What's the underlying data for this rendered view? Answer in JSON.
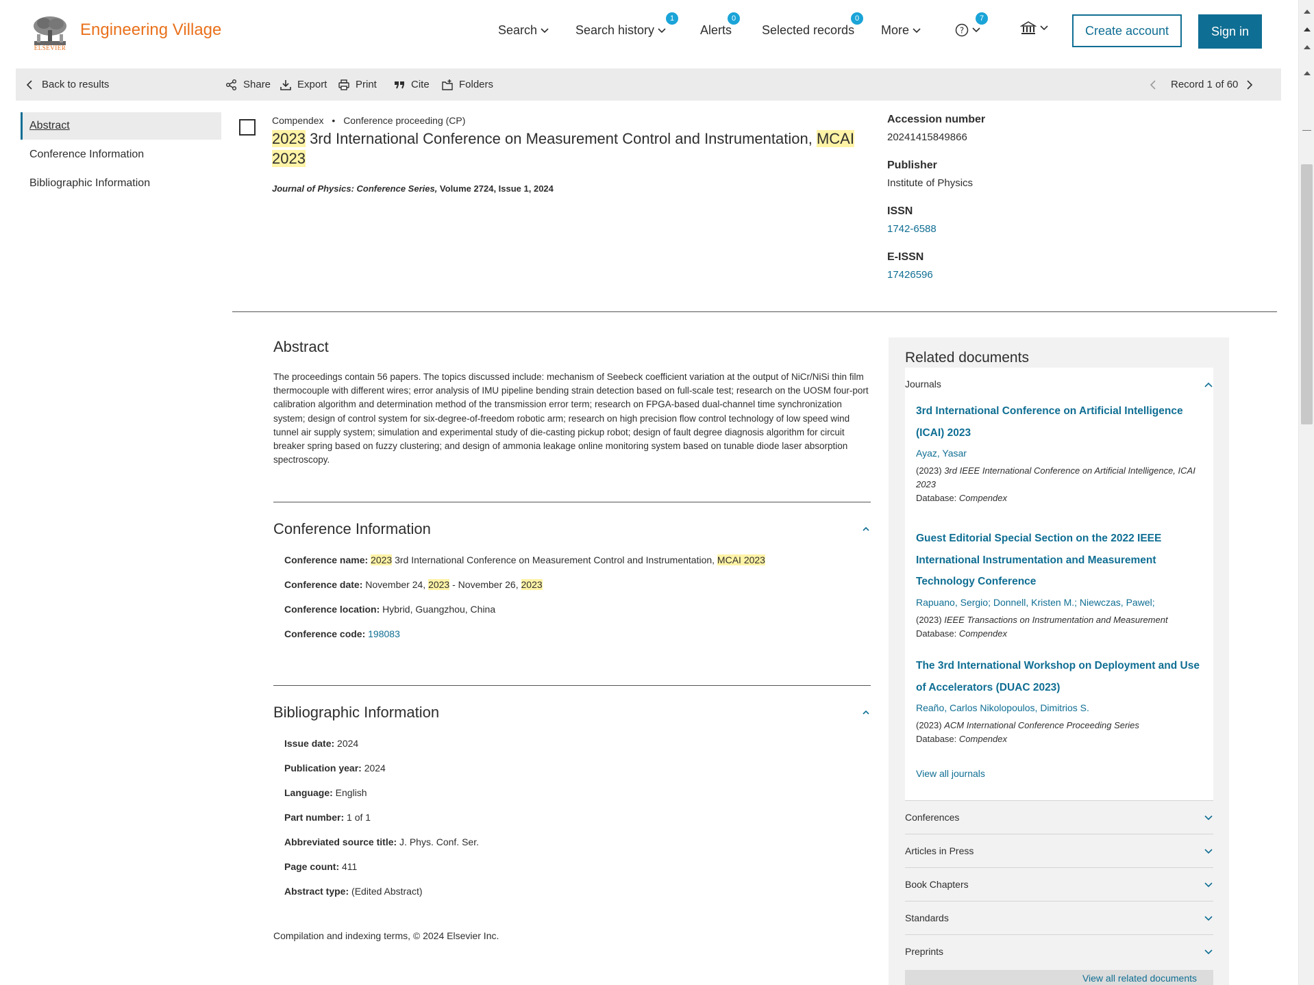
{
  "header": {
    "brand": "Engineering Village",
    "logo_word": "ELSEVIER",
    "nav": {
      "search": "Search",
      "search_history": "Search history",
      "search_history_badge": "1",
      "alerts": "Alerts",
      "alerts_badge": "0",
      "selected_records": "Selected records",
      "selected_records_badge": "0",
      "more": "More",
      "help_badge": "7"
    },
    "create_account": "Create account",
    "sign_in": "Sign in"
  },
  "toolbar": {
    "back": "Back to results",
    "share": "Share",
    "export": "Export",
    "print": "Print",
    "cite": "Cite",
    "folders": "Folders",
    "record_position": "Record 1 of 60"
  },
  "leftnav": {
    "abstract": "Abstract",
    "conference_information": "Conference Information",
    "bibliographic_information": "Bibliographic Information"
  },
  "record": {
    "database": "Compendex",
    "separator": "•",
    "doc_type": "Conference proceeding (CP)",
    "title_hl_1": "2023",
    "title_mid": " 3rd International Conference on Measurement Control and Instrumentation, ",
    "title_hl_2": "MCAI",
    "title_hl_3": "2023",
    "source_journal": "Journal of Physics: Conference Series,",
    "source_rest": " Volume 2724, Issue 1, 2024"
  },
  "right_meta": {
    "accession_label": "Accession number",
    "accession_value": "20241415849866",
    "publisher_label": "Publisher",
    "publisher_value": "Institute of Physics",
    "issn_label": "ISSN",
    "issn_value": "1742-6588",
    "eissn_label": "E-ISSN",
    "eissn_value": "17426596"
  },
  "abstract": {
    "heading": "Abstract",
    "text": "The proceedings contain 56 papers. The topics discussed include: mechanism of Seebeck coefficient variation at the output of NiCr/NiSi thin film thermocouple with different wires; error analysis of IMU pipeline bending strain detection based on full-scale test; research on the UOSM four-port calibration algorithm and determination method of the transmission error term; research on FPGA-based dual-channel time synchronization system; design of control system for six-degree-of-freedom robotic arm; research on high precision flow control technology of low speed wind tunnel air supply system; simulation and experimental study of die-casting pickup robot; design of fault degree diagnosis algorithm for circuit breaker spring based on fuzzy clustering; and design of ammonia leakage online monitoring system based on tunable diode laser absorption spectroscopy."
  },
  "conference": {
    "heading": "Conference Information",
    "name_label": "Conference name:",
    "name_hl_1": "2023",
    "name_mid": " 3rd International Conference on Measurement Control and Instrumentation, ",
    "name_hl_2": "MCAI",
    "name_hl_3": "2023",
    "date_label": "Conference date:",
    "date_part1": "November 24, ",
    "date_hl_1": "2023",
    "date_part2": " - November 26, ",
    "date_hl_2": "2023",
    "location_label": "Conference location:",
    "location_value": "Hybrid, Guangzhou, China",
    "code_label": "Conference code:",
    "code_value": "198083"
  },
  "bibliographic": {
    "heading": "Bibliographic Information",
    "issue_date_label": "Issue date:",
    "issue_date_value": "2024",
    "pub_year_label": "Publication year:",
    "pub_year_value": "2024",
    "language_label": "Language:",
    "language_value": "English",
    "part_label": "Part number:",
    "part_value": "1 of 1",
    "abbrev_label": "Abbreviated source title:",
    "abbrev_value": "J. Phys. Conf. Ser.",
    "page_count_label": "Page count:",
    "page_count_value": "411",
    "abstract_type_label": "Abstract type:",
    "abstract_type_value": "(Edited Abstract)"
  },
  "footer_note": "Compilation and indexing terms, © 2024 Elsevier Inc.",
  "related": {
    "heading": "Related documents",
    "journals_label": "Journals",
    "items": [
      {
        "title": "3rd International Conference on Artificial Intelligence (ICAI) 2023",
        "authors": "Ayaz, Yasar",
        "year": "(2023)",
        "source": "3rd IEEE International Conference on Artificial Intelligence, ICAI 2023",
        "db_label": "Database:",
        "db": "Compendex"
      },
      {
        "title": "Guest Editorial Special Section on the 2022 IEEE International Instrumentation and Measurement Technology Conference",
        "authors": "Rapuano, Sergio; Donnell, Kristen M.; Niewczas, Pawel;",
        "year": "(2023)",
        "source": "IEEE Transactions on Instrumentation and Measurement",
        "db_label": "Database:",
        "db": "Compendex"
      },
      {
        "title": "The 3rd International Workshop on Deployment and Use of Accelerators (DUAC 2023)",
        "authors": "Reaño, Carlos Nikolopoulos, Dimitrios S.",
        "year": "(2023)",
        "source": "ACM International Conference Proceeding Series",
        "db_label": "Database:",
        "db": "Compendex"
      }
    ],
    "view_all_journals": "View all journals",
    "categories": {
      "conferences": "Conferences",
      "articles_in_press": "Articles in Press",
      "book_chapters": "Book Chapters",
      "standards": "Standards",
      "preprints": "Preprints"
    },
    "view_all_related": "View all related documents"
  },
  "colors": {
    "brand_orange": "#e9711c",
    "link_teal": "#0f6e93",
    "badge_blue": "#1aa4d8",
    "highlight_yellow": "#fff3a6"
  }
}
